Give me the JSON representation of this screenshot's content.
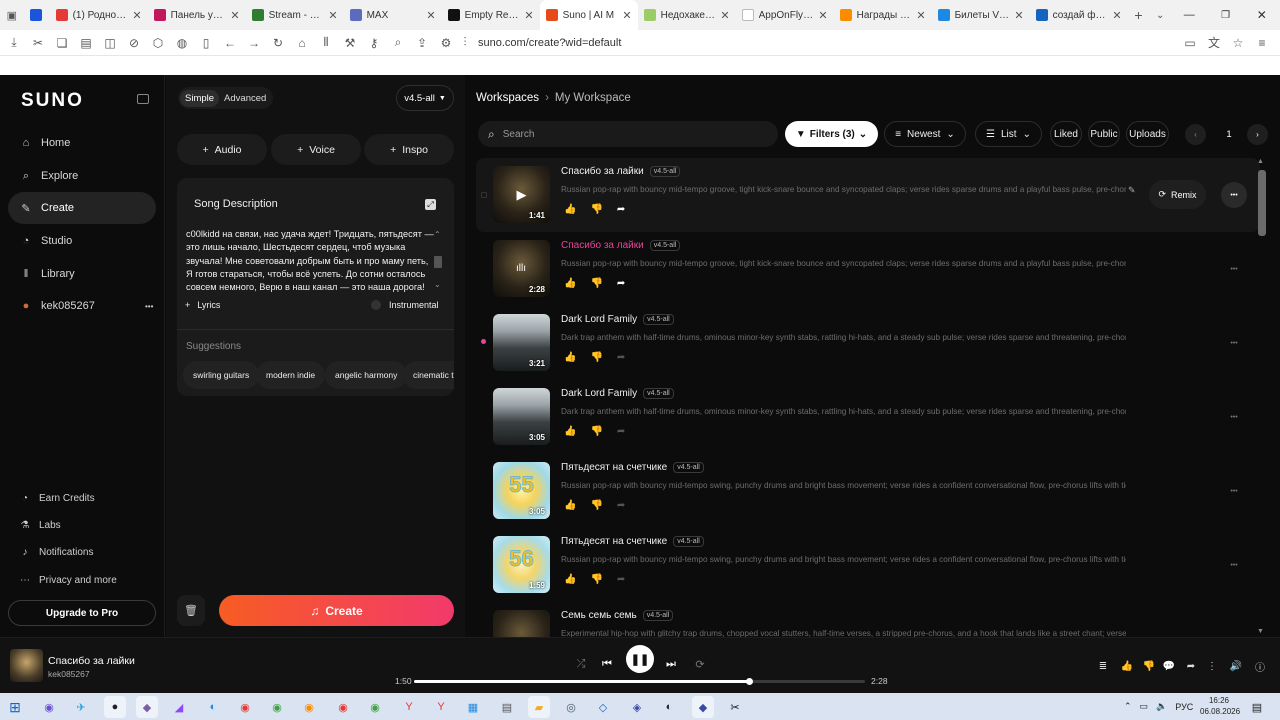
{
  "browser": {
    "tabs": [
      {
        "title": "",
        "color": "#1a56db",
        "active": false
      },
      {
        "title": "(1) Родной союз",
        "color": "#e53935",
        "active": false
      },
      {
        "title": "Панель управле",
        "color": "#c2185b",
        "active": false
      },
      {
        "title": "Stream - Kick Da",
        "color": "#2e7d32",
        "active": false
      },
      {
        "title": "MAX",
        "color": "#5c6bc0",
        "active": false
      },
      {
        "title": "Empty Request /",
        "color": "#111111",
        "active": false
      },
      {
        "title": "Suno | AI M",
        "color": "#e64a19",
        "active": true
      },
      {
        "title": "Недохакеры",
        "color": "#9ccc65",
        "active": false
      },
      {
        "title": "AppOnFly Wind",
        "color": "#ffffff",
        "active": false
      },
      {
        "title": "Награды за гол",
        "color": "#fb8c00",
        "active": false
      },
      {
        "title": "Билеты V2 | A D",
        "color": "#1e88e5",
        "active": false
      },
      {
        "title": "создай фото 60",
        "color": "#1565c0",
        "active": false
      }
    ],
    "url": "suno.com/create?wid=default"
  },
  "sidebar": {
    "logo": "SUNO",
    "nav": [
      {
        "label": "Home",
        "icon": "home-icon",
        "glyph": "⌂"
      },
      {
        "label": "Explore",
        "icon": "search-icon",
        "glyph": "⌕"
      },
      {
        "label": "Create",
        "icon": "create-icon",
        "glyph": "✎",
        "active": true
      },
      {
        "label": "Studio",
        "icon": "studio-icon",
        "glyph": "◔"
      },
      {
        "label": "Library",
        "icon": "library-icon",
        "glyph": "‖"
      },
      {
        "label": "kek085267",
        "icon": "avatar-icon",
        "glyph": "●"
      }
    ],
    "bottom_nav": [
      {
        "label": "Earn Credits",
        "icon": "earn-icon",
        "glyph": "◔"
      },
      {
        "label": "Labs",
        "icon": "labs-icon",
        "glyph": "⚗"
      },
      {
        "label": "Notifications",
        "icon": "bell-icon",
        "glyph": "♪"
      },
      {
        "label": "Privacy and more",
        "icon": "more-icon",
        "glyph": "⋯"
      }
    ],
    "upgrade_label": "Upgrade to Pro",
    "more_glyph": "•••"
  },
  "create_panel": {
    "mode_simple": "Simple",
    "mode_advanced": "Advanced",
    "version": "v4.5-all",
    "chips": [
      "Audio",
      "Voice",
      "Inspo"
    ],
    "desc_title": "Song Description",
    "desc_text": "c00lkidd на связи, нас удача ждет! Тридцать, пятьдесят — это лишь начало, Шестьдесят сердец, чтоб музыка звучала! Мне советовали добрым быть и про маму петь, Я готов стараться, чтобы всё успеть. До сотни осталось совсем немного, Верю в наш канал — это наша дорога!",
    "lyrics_label": "Lyrics",
    "instrumental_label": "Instrumental",
    "suggestions_title": "Suggestions",
    "suggestions": [
      "swirling guitars",
      "modern indie",
      "angelic harmony",
      "cinematic te"
    ],
    "create_label": "Create"
  },
  "workspace": {
    "crumb_root": "Workspaces",
    "crumb_sep": "›",
    "crumb_current": "My Workspace",
    "search_placeholder": "Search",
    "filters_label": "Filters (3)",
    "sort_label": "Newest",
    "view_label": "List",
    "liked_label": "Liked",
    "public_label": "Public",
    "uploads_label": "Uploads",
    "page": "1",
    "remix_label": "Remix",
    "songs": [
      {
        "title": "Спасибо за лайки",
        "version": "v4.5-all",
        "duration": "1:41",
        "desc": "Russian pop-rap with bouncy mid-tempo groove, tight kick-snare bounce and syncopated claps; verse rides sparse drums and a playful bass pulse, pre-chorus strips...",
        "highlight": true,
        "thumb": "dark",
        "playing": false
      },
      {
        "title": "Спасибо за лайки",
        "version": "v4.5-all",
        "duration": "2:28",
        "desc": "Russian pop-rap with bouncy mid-tempo groove, tight kick-snare bounce and syncopated claps; verse rides sparse drums and a playful bass pulse, pre-chorus strips...",
        "pink": true,
        "thumb": "dark",
        "playing": true
      },
      {
        "title": "Dark Lord Family",
        "version": "v4.5-all",
        "duration": "3:21",
        "desc": "Dark trap anthem with half-time drums, ominous minor-key synth stabs, rattling hi-hats, and a steady sub pulse; verse rides sparse and threatening, pre-chorus strips...",
        "thumb": "grid",
        "dot": true,
        "dim": true
      },
      {
        "title": "Dark Lord Family",
        "version": "v4.5-all",
        "duration": "3:05",
        "desc": "Dark trap anthem with half-time drums, ominous minor-key synth stabs, rattling hi-hats, and a steady sub pulse; verse rides sparse and threatening, pre-chorus strips...",
        "thumb": "grid",
        "dim": true
      },
      {
        "title": "Пятьдесят на счетчике",
        "version": "v4.5-all",
        "duration": "3:05",
        "desc": "Russian pop-rap with bouncy mid-tempo swing, punchy drums and bright bass movement; verse rides a confident conversational flow, pre-chorus lifts with tighter rh...",
        "thumb": "n55",
        "bigtext": "55",
        "dim": true
      },
      {
        "title": "Пятьдесят на счетчике",
        "version": "v4.5-all",
        "duration": "1:59",
        "desc": "Russian pop-rap with bouncy mid-tempo swing, punchy drums and bright bass movement; verse rides a confident conversational flow, pre-chorus lifts with tighter rh...",
        "thumb": "n56",
        "bigtext": "56",
        "dim": true
      },
      {
        "title": "Семь семь семь",
        "version": "v4.5-all",
        "duration": "",
        "desc": "Experimental hip-hop with glitchy trap drums, chopped vocal stutters, half-time verses, a stripped pre-chorus, and a hook that lands like a street chant; verse rides ch...",
        "thumb": "dark",
        "dim": true
      }
    ]
  },
  "player": {
    "title": "Спасибо за лайки",
    "user": "kek085267",
    "current": "1:50",
    "total": "2:28",
    "progress": 0.743
  },
  "taskbar": {
    "lang": "РУС",
    "time": "16:26",
    "date": "06.08.2026"
  },
  "colors": {
    "accent_pink": "#e8449a",
    "create_gradient_start": "#f75c23",
    "create_gradient_end": "#f23a6b"
  }
}
